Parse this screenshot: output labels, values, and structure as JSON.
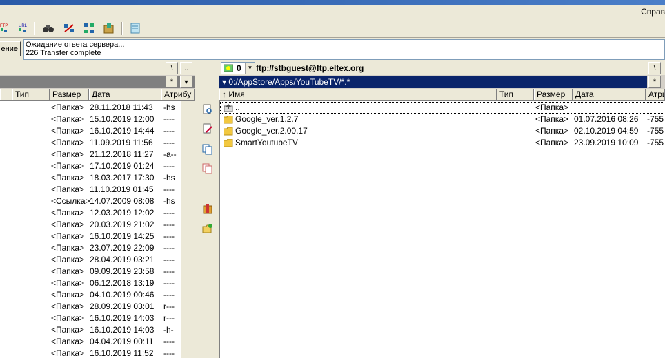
{
  "menu": {
    "help": "Справ"
  },
  "connect_button": "ение",
  "log": {
    "line1": "Ожидание ответа сервера...",
    "line2": "226 Transfer complete"
  },
  "left_panel": {
    "root_btn": "\\",
    "up_btn": "..",
    "filter_btn": "*",
    "headers": {
      "type": "Тип",
      "size": "Размер",
      "date": "Дата",
      "attr": "Атрибу"
    },
    "rows": [
      {
        "size": "<Папка>",
        "date": "28.11.2018 11:43",
        "attr": "-hs"
      },
      {
        "size": "<Папка>",
        "date": "15.10.2019 12:00",
        "attr": "----"
      },
      {
        "size": "<Папка>",
        "date": "16.10.2019 14:44",
        "attr": "----"
      },
      {
        "size": "<Папка>",
        "date": "11.09.2019 11:56",
        "attr": "----"
      },
      {
        "size": "<Папка>",
        "date": "21.12.2018 11:27",
        "attr": "-a--"
      },
      {
        "size": "<Папка>",
        "date": "17.10.2019 01:24",
        "attr": "----"
      },
      {
        "size": "<Папка>",
        "date": "18.03.2017 17:30",
        "attr": "-hs"
      },
      {
        "size": "<Папка>",
        "date": "11.10.2019 01:45",
        "attr": "----"
      },
      {
        "size": "<Ссылка>",
        "date": "14.07.2009 08:08",
        "attr": "-hs"
      },
      {
        "size": "<Папка>",
        "date": "12.03.2019 12:02",
        "attr": "----"
      },
      {
        "size": "<Папка>",
        "date": "20.03.2019 21:02",
        "attr": "----"
      },
      {
        "size": "<Папка>",
        "date": "16.10.2019 14:25",
        "attr": "----"
      },
      {
        "size": "<Папка>",
        "date": "23.07.2019 22:09",
        "attr": "----"
      },
      {
        "size": "<Папка>",
        "date": "28.04.2019 03:21",
        "attr": "----"
      },
      {
        "size": "<Папка>",
        "date": "09.09.2019 23:58",
        "attr": "----"
      },
      {
        "size": "<Папка>",
        "date": "06.12.2018 13:19",
        "attr": "----"
      },
      {
        "size": "<Папка>",
        "date": "04.10.2019 00:46",
        "attr": "----"
      },
      {
        "size": "<Папка>",
        "date": "28.09.2019 03:01",
        "attr": "r---"
      },
      {
        "size": "<Папка>",
        "date": "16.10.2019 14:03",
        "attr": "r---"
      },
      {
        "size": "<Папка>",
        "date": "16.10.2019 14:03",
        "attr": "-h-"
      },
      {
        "size": "<Папка>",
        "date": "04.04.2019 00:11",
        "attr": "----"
      },
      {
        "size": "<Папка>",
        "date": "16.10.2019 11:52",
        "attr": "----"
      }
    ]
  },
  "right_panel": {
    "drive": "0",
    "url": "ftp://stbguest@ftp.eltex.org",
    "root_btn": "\\",
    "filter_btn": "*",
    "filter_path": "▾ 0:/AppStore/Apps/YouTubeTV/*.*",
    "headers": {
      "name": "↑ Имя",
      "type": "Тип",
      "size": "Размер",
      "date": "Дата",
      "attr": "Атри"
    },
    "rows": [
      {
        "name": "..",
        "size": "<Папка>",
        "date": "",
        "attr": "",
        "icon": "up-dir-icon"
      },
      {
        "name": "Google_ver.1.2.7",
        "size": "<Папка>",
        "date": "01.07.2016 08:26",
        "attr": "-755",
        "icon": "folder-icon"
      },
      {
        "name": "Google_ver.2.00.17",
        "size": "<Папка>",
        "date": "02.10.2019 04:59",
        "attr": "-755",
        "icon": "folder-icon"
      },
      {
        "name": "SmartYoutubeTV",
        "size": "<Папка>",
        "date": "23.09.2019 10:09",
        "attr": "-755",
        "icon": "folder-icon"
      }
    ]
  },
  "toolbar_icons": [
    "ftp-connect-icon",
    "url-connect-icon",
    "search-icon",
    "sync-icon",
    "tree-icon",
    "pack-icon",
    "notepad-icon"
  ]
}
